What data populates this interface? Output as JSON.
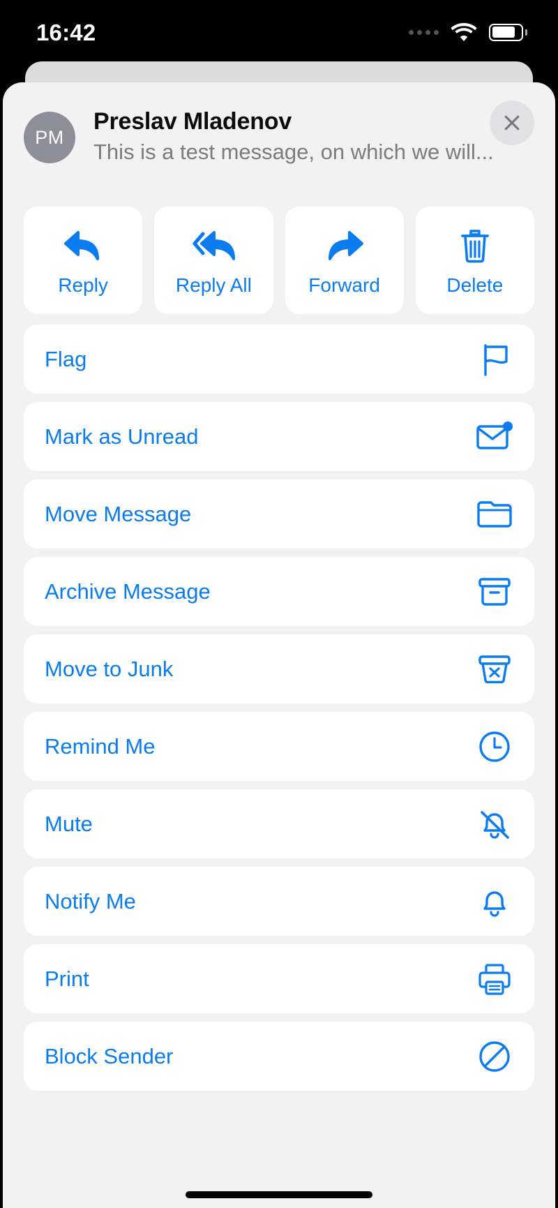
{
  "status_bar": {
    "time": "16:42",
    "signal_icon": "cellular-dots-icon",
    "wifi_icon": "wifi-icon",
    "battery_icon": "battery-icon",
    "battery_level_percent": 82
  },
  "header": {
    "avatar_initials": "PM",
    "avatar_color": "#8e8e9a",
    "sender_name": "Preslav Mladenov",
    "preview_text": "This is a test message, on which we will...",
    "close_icon": "close-icon"
  },
  "theme": {
    "accent": "#0a7cf0",
    "sheet_background": "#f2f2f2",
    "card_background": "#ffffff",
    "secondary_text": "#7b7b80"
  },
  "quick_actions": [
    {
      "label": "Reply",
      "icon": "reply-icon"
    },
    {
      "label": "Reply All",
      "icon": "reply-all-icon"
    },
    {
      "label": "Forward",
      "icon": "forward-icon"
    },
    {
      "label": "Delete",
      "icon": "trash-icon"
    }
  ],
  "menu_items": [
    {
      "label": "Flag",
      "icon": "flag-icon"
    },
    {
      "label": "Mark as Unread",
      "icon": "envelope-badge-icon"
    },
    {
      "label": "Move Message",
      "icon": "folder-icon"
    },
    {
      "label": "Archive Message",
      "icon": "archivebox-icon"
    },
    {
      "label": "Move to Junk",
      "icon": "junk-bin-icon"
    },
    {
      "label": "Remind Me",
      "icon": "clock-icon"
    },
    {
      "label": "Mute",
      "icon": "bell-slash-icon"
    },
    {
      "label": "Notify Me",
      "icon": "bell-icon"
    },
    {
      "label": "Print",
      "icon": "printer-icon"
    },
    {
      "label": "Block Sender",
      "icon": "block-icon"
    }
  ],
  "home_indicator": "home-indicator"
}
